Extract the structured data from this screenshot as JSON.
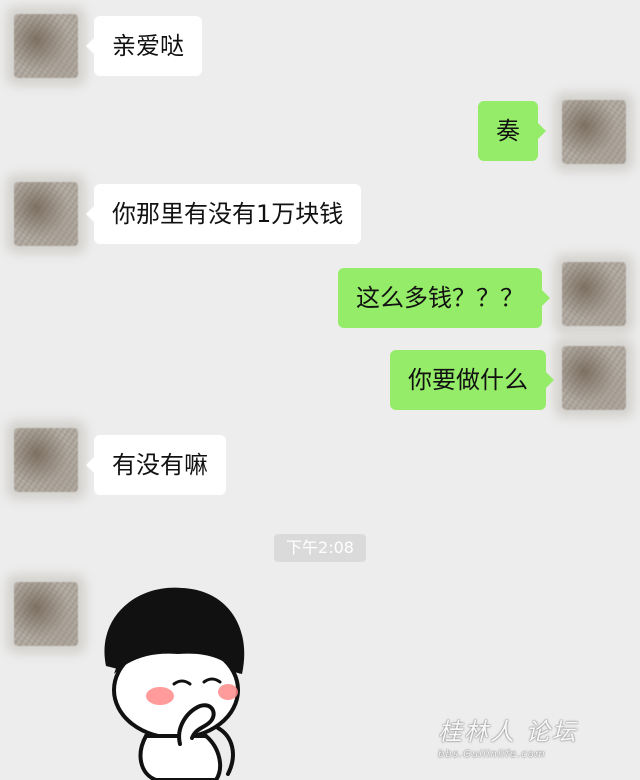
{
  "messages": [
    {
      "side": "in",
      "text": "亲爱哒"
    },
    {
      "side": "out",
      "text": "奏"
    },
    {
      "side": "in",
      "text": "你那里有没有1万块钱"
    },
    {
      "side": "out",
      "text": "这么多钱？？？"
    },
    {
      "side": "out",
      "text": "你要做什么"
    },
    {
      "side": "in",
      "text": "有没有嘛"
    }
  ],
  "timestamp": "下午2:08",
  "sticker": {
    "icon": "shy-girl-sticker-icon"
  },
  "watermark": {
    "main": "桂林人 论坛",
    "sub": "bbs.Guilinlife.com"
  },
  "colors": {
    "background": "#ededed",
    "incoming_bubble": "#ffffff",
    "outgoing_bubble": "#95ec69"
  }
}
